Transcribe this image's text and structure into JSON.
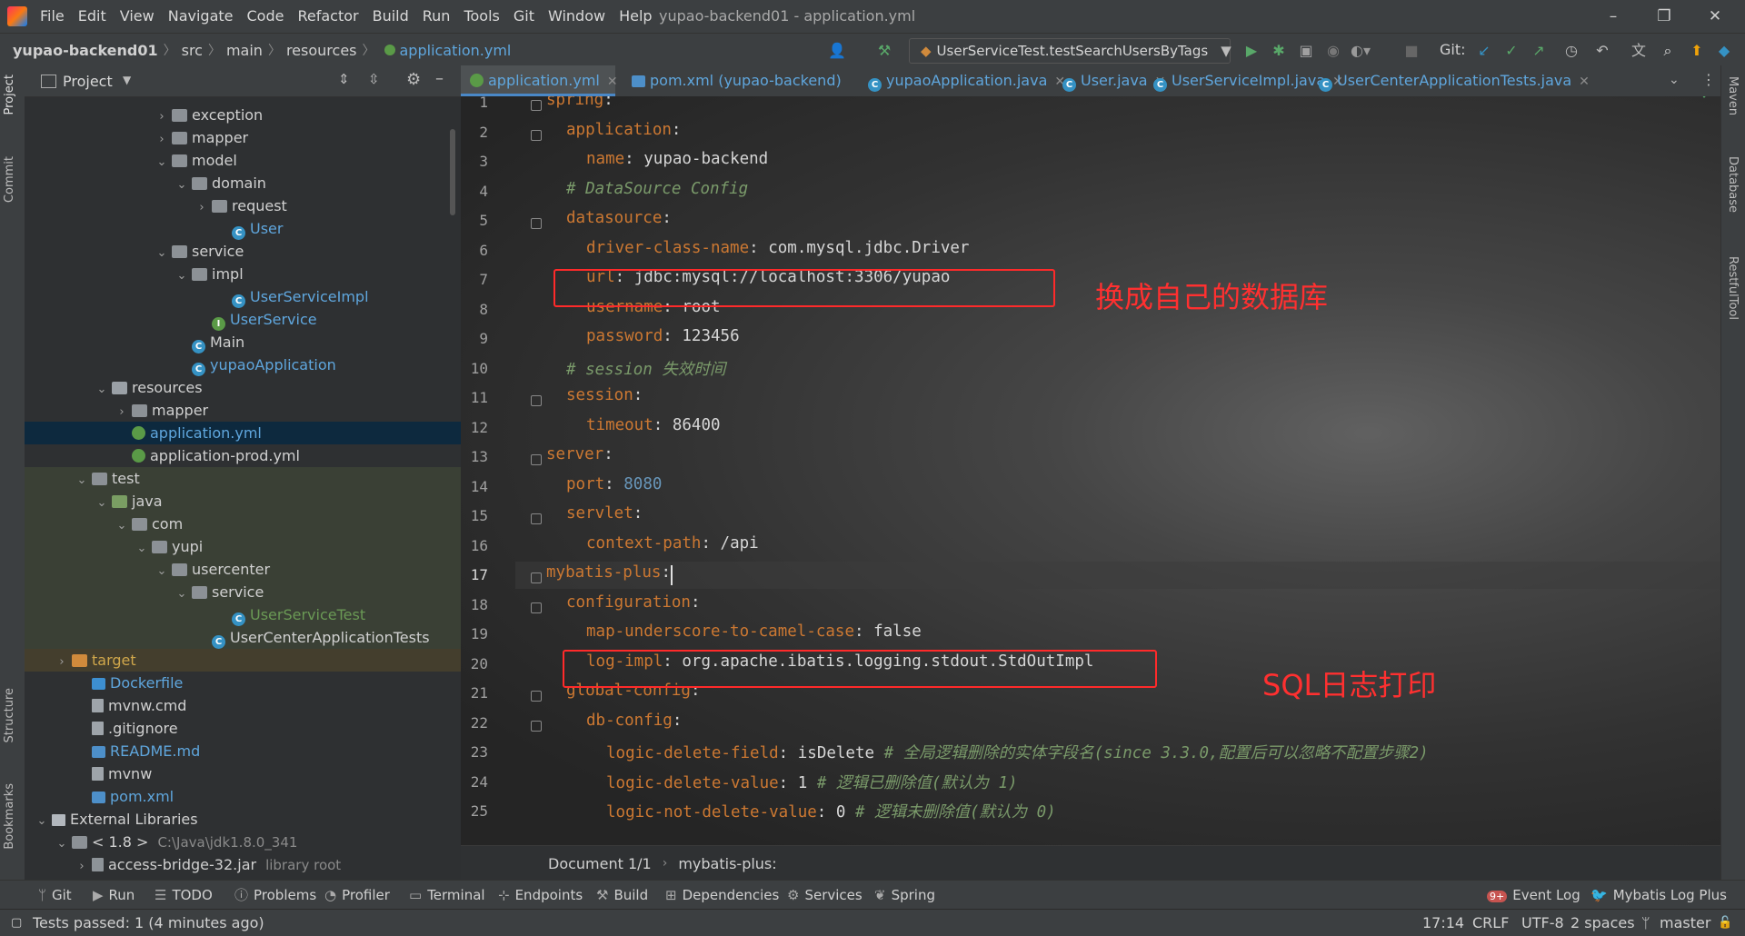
{
  "menu": [
    "File",
    "Edit",
    "View",
    "Navigate",
    "Code",
    "Refactor",
    "Build",
    "Run",
    "Tools",
    "Git",
    "Window",
    "Help"
  ],
  "window_title": "yupao-backend01 - application.yml",
  "breadcrumb": [
    "yupao-backend01",
    "src",
    "main",
    "resources",
    "application.yml"
  ],
  "run_config": "UserServiceTest.testSearchUsersByTags",
  "git_label": "Git:",
  "project_panel": {
    "title": "Project",
    "tree": [
      {
        "label": "exception",
        "type": "folder",
        "depth": 6,
        "arrow": "›"
      },
      {
        "label": "mapper",
        "type": "folder",
        "depth": 6,
        "arrow": "›"
      },
      {
        "label": "model",
        "type": "folder",
        "depth": 6,
        "arrow": "⌄"
      },
      {
        "label": "domain",
        "type": "folder",
        "depth": 7,
        "arrow": "⌄"
      },
      {
        "label": "request",
        "type": "folder",
        "depth": 8,
        "arrow": "›"
      },
      {
        "label": "User",
        "type": "class",
        "depth": 9,
        "arrow": ""
      },
      {
        "label": "service",
        "type": "folder",
        "depth": 6,
        "arrow": "⌄"
      },
      {
        "label": "impl",
        "type": "folder",
        "depth": 7,
        "arrow": "⌄"
      },
      {
        "label": "UserServiceImpl",
        "type": "class",
        "depth": 9,
        "arrow": ""
      },
      {
        "label": "UserService",
        "type": "interface",
        "depth": 8,
        "arrow": ""
      },
      {
        "label": "Main",
        "type": "class-plain",
        "depth": 7,
        "arrow": ""
      },
      {
        "label": "yupaoApplication",
        "type": "class",
        "depth": 7,
        "arrow": ""
      },
      {
        "label": "resources",
        "type": "res-folder",
        "depth": 3,
        "arrow": "⌄"
      },
      {
        "label": "mapper",
        "type": "folder",
        "depth": 4,
        "arrow": "›"
      },
      {
        "label": "application.yml",
        "type": "yml",
        "depth": 4,
        "arrow": "",
        "selected": true
      },
      {
        "label": "application-prod.yml",
        "type": "yml-plain",
        "depth": 4,
        "arrow": ""
      },
      {
        "label": "test",
        "type": "folder",
        "depth": 2,
        "arrow": "⌄"
      },
      {
        "label": "java",
        "type": "src-folder",
        "depth": 3,
        "arrow": "⌄"
      },
      {
        "label": "com",
        "type": "folder",
        "depth": 4,
        "arrow": "⌄"
      },
      {
        "label": "yupi",
        "type": "folder",
        "depth": 5,
        "arrow": "⌄"
      },
      {
        "label": "usercenter",
        "type": "folder",
        "depth": 6,
        "arrow": "⌄"
      },
      {
        "label": "service",
        "type": "folder",
        "depth": 7,
        "arrow": "⌄"
      },
      {
        "label": "UserServiceTest",
        "type": "class",
        "depth": 9,
        "arrow": ""
      },
      {
        "label": "UserCenterApplicationTests",
        "type": "class-plain",
        "depth": 8,
        "arrow": ""
      },
      {
        "label": "target",
        "type": "excl-folder",
        "depth": 1,
        "arrow": "›"
      },
      {
        "label": "Dockerfile",
        "type": "docker",
        "depth": 2,
        "arrow": ""
      },
      {
        "label": "mvnw.cmd",
        "type": "file",
        "depth": 2,
        "arrow": ""
      },
      {
        "label": ".gitignore",
        "type": "file",
        "depth": 2,
        "arrow": ""
      },
      {
        "label": "README.md",
        "type": "md",
        "depth": 2,
        "arrow": ""
      },
      {
        "label": "mvnw",
        "type": "file",
        "depth": 2,
        "arrow": ""
      },
      {
        "label": "pom.xml",
        "type": "pom",
        "depth": 2,
        "arrow": ""
      },
      {
        "label": "External Libraries",
        "type": "lib",
        "depth": 0,
        "arrow": "⌄"
      },
      {
        "label": "< 1.8 >",
        "type": "jdk",
        "depth": 1,
        "arrow": "⌄",
        "extra": "C:\\Java\\jdk1.8.0_341"
      },
      {
        "label": "access-bridge-32.jar",
        "type": "jar",
        "depth": 2,
        "arrow": "›",
        "extra": "library root"
      }
    ]
  },
  "editor_tabs": [
    {
      "label": "application.yml",
      "active": true
    },
    {
      "label": "pom.xml (yupao-backend)"
    },
    {
      "label": "yupaoApplication.java"
    },
    {
      "label": "User.java"
    },
    {
      "label": "UserServiceImpl.java"
    },
    {
      "label": "UserCenterApplicationTests.java"
    }
  ],
  "code": [
    {
      "n": "1",
      "indent": 0,
      "key": "spring",
      "val": "",
      "comment": ""
    },
    {
      "n": "2",
      "indent": 1,
      "key": "application",
      "val": "",
      "comment": ""
    },
    {
      "n": "3",
      "indent": 2,
      "key": "name",
      "val": "yupao-backend",
      "comment": ""
    },
    {
      "n": "4",
      "indent": 1,
      "key": "",
      "val": "",
      "comment": "# DataSource Config"
    },
    {
      "n": "5",
      "indent": 1,
      "key": "datasource",
      "val": "",
      "comment": ""
    },
    {
      "n": "6",
      "indent": 2,
      "key": "driver-class-name",
      "val": "com.mysql.jdbc.Driver",
      "comment": ""
    },
    {
      "n": "7",
      "indent": 2,
      "key": "url",
      "val": "jdbc:mysql://localhost:3306/yupao",
      "comment": ""
    },
    {
      "n": "8",
      "indent": 2,
      "key": "username",
      "val": "root",
      "comment": ""
    },
    {
      "n": "9",
      "indent": 2,
      "key": "password",
      "val": "123456",
      "comment": "",
      "num": true
    },
    {
      "n": "10",
      "indent": 1,
      "key": "",
      "val": "",
      "comment": "# session 失效时间"
    },
    {
      "n": "11",
      "indent": 1,
      "key": "session",
      "val": "",
      "comment": ""
    },
    {
      "n": "12",
      "indent": 2,
      "key": "timeout",
      "val": "86400",
      "comment": "",
      "num": true
    },
    {
      "n": "13",
      "indent": 0,
      "key": "server",
      "val": "",
      "comment": ""
    },
    {
      "n": "14",
      "indent": 1,
      "key": "port",
      "val": "8080",
      "comment": "",
      "num": true,
      "blue": true
    },
    {
      "n": "15",
      "indent": 1,
      "key": "servlet",
      "val": "",
      "comment": ""
    },
    {
      "n": "16",
      "indent": 2,
      "key": "context-path",
      "val": "/api",
      "comment": ""
    },
    {
      "n": "17",
      "indent": 0,
      "key": "mybatis-plus",
      "val": "",
      "comment": ""
    },
    {
      "n": "18",
      "indent": 1,
      "key": "configuration",
      "val": "",
      "comment": ""
    },
    {
      "n": "19",
      "indent": 2,
      "key": "map-underscore-to-camel-case",
      "val": "false",
      "comment": ""
    },
    {
      "n": "20",
      "indent": 2,
      "key": "log-impl",
      "val": "org.apache.ibatis.logging.stdout.StdOutImpl",
      "comment": ""
    },
    {
      "n": "21",
      "indent": 1,
      "key": "global-config",
      "val": "",
      "comment": ""
    },
    {
      "n": "22",
      "indent": 2,
      "key": "db-config",
      "val": "",
      "comment": ""
    },
    {
      "n": "23",
      "indent": 3,
      "key": "logic-delete-field",
      "val": "isDelete",
      "comment": "# 全局逻辑删除的实体字段名(since 3.3.0,配置后可以忽略不配置步骤2)"
    },
    {
      "n": "24",
      "indent": 3,
      "key": "logic-delete-value",
      "val": "1",
      "comment": "# 逻辑已删除值(默认为 1)"
    },
    {
      "n": "25",
      "indent": 3,
      "key": "logic-not-delete-value",
      "val": "0",
      "comment": "# 逻辑未删除值(默认为 0)"
    }
  ],
  "annotations": {
    "db": "换成自己的数据库",
    "sql_log": "SQL日志打印"
  },
  "editor_breadcrumbs": [
    "Document 1/1",
    "mybatis-plus:"
  ],
  "left_stripe": [
    "Project",
    "Commit",
    "Structure",
    "Bookmarks"
  ],
  "right_stripe": [
    "Maven",
    "Database",
    "RestfulTool"
  ],
  "toolwindows": [
    "Git",
    "Run",
    "TODO",
    "Problems",
    "Profiler",
    "Terminal",
    "Endpoints",
    "Build",
    "Dependencies",
    "Services",
    "Spring"
  ],
  "event_log": {
    "count": "9+",
    "label": "Event Log"
  },
  "mybatis_log": "Mybatis Log Plus",
  "status": {
    "message": "Tests passed: 1 (4 minutes ago)",
    "position": "17:14",
    "line_sep": "CRLF",
    "encoding": "UTF-8",
    "indent": "2 spaces",
    "branch": "master"
  }
}
